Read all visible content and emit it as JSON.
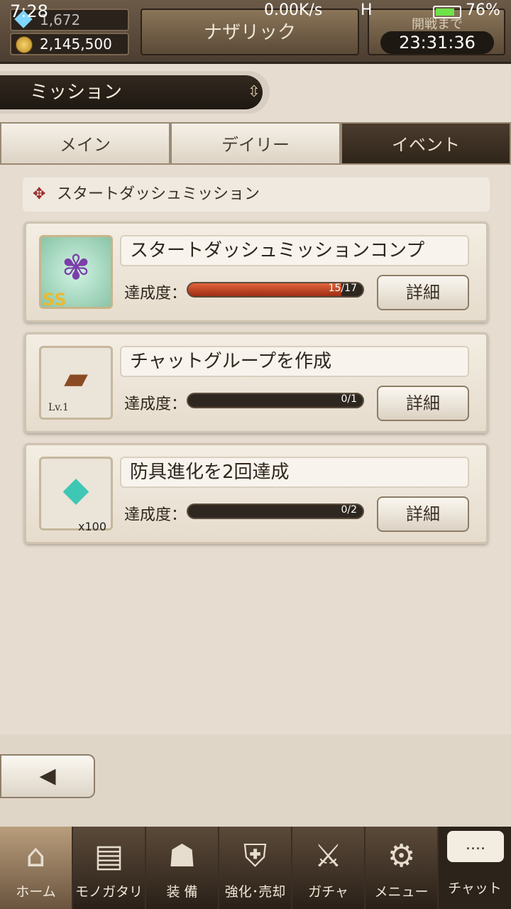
{
  "status": {
    "time": "7:28",
    "net": "0.00K/s",
    "signal": "H",
    "battery": "76%"
  },
  "header": {
    "gems": "1,672",
    "coins": "2,145,500",
    "title": "ナザリック",
    "timer_label": "開戦まで",
    "timer_value": "23:31:36"
  },
  "mission_bar": {
    "title": "ミッション"
  },
  "tabs": [
    {
      "label": "メイン"
    },
    {
      "label": "デイリー"
    },
    {
      "label": "イベント"
    }
  ],
  "section": {
    "title": "スタートダッシュミッション"
  },
  "missions": [
    {
      "name": "スタートダッシュミッションコンプ",
      "progress_label": "達成度：",
      "progress_text": "15/17",
      "progress": 0.882,
      "button": "詳細",
      "badge": "SS"
    },
    {
      "name": "チャットグループを作成",
      "progress_label": "達成度：",
      "progress_text": "0/1",
      "progress": 0.0,
      "button": "詳細",
      "badge": "Lv.1"
    },
    {
      "name": "防具進化を2回達成",
      "progress_label": "達成度：",
      "progress_text": "0/2",
      "progress": 0.0,
      "button": "詳細",
      "badge": "x100"
    }
  ],
  "bottom_nav": [
    {
      "label": "ホーム",
      "icon": "castle-icon"
    },
    {
      "label": "モノガタリ",
      "icon": "book-icon"
    },
    {
      "label": "装 備",
      "icon": "armor-icon"
    },
    {
      "label": "強化･売却",
      "icon": "shield-icon"
    },
    {
      "label": "ガチャ",
      "icon": "swords-icon"
    },
    {
      "label": "メニュー",
      "icon": "gear-icon"
    }
  ],
  "chat": {
    "label": "チャット",
    "bubble": "...."
  }
}
